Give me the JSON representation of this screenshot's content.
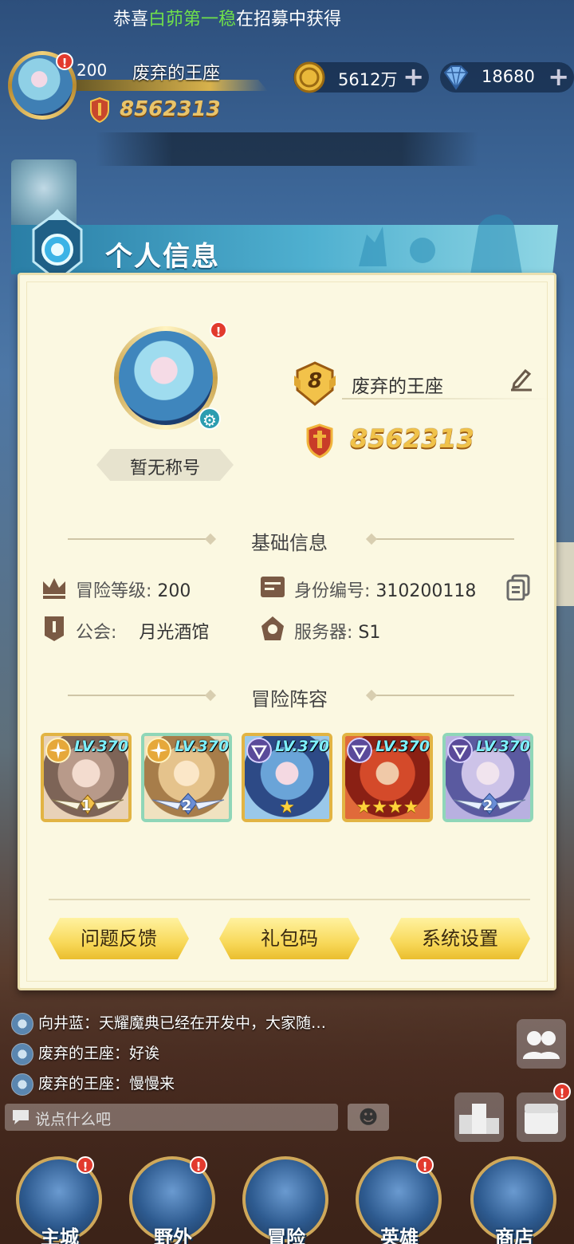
{
  "hud": {
    "level": "200",
    "player_name": "废弃的王座",
    "power": "8562313",
    "gold": "5612万",
    "gems": "18680",
    "plus": "+",
    "ticker_prefix": "恭喜",
    "ticker_highlight": "白茆第一稳",
    "ticker_suffix": "在招募中获得"
  },
  "dialog": {
    "title": "个人信息",
    "player_title": "暂无称号",
    "rank": "8",
    "name": "废弃的王座",
    "power": "8562313",
    "basic_section": "基础信息",
    "adv_level_label": "冒险等级:",
    "adv_level_value": "200",
    "id_label": "身份编号:",
    "id_value": "310200118",
    "guild_label": "公会:",
    "guild_value": "月光酒馆",
    "server_label": "服务器:",
    "server_value": "S1",
    "lineup_section": "冒险阵容",
    "heroes": [
      {
        "level": "LV.370",
        "badge": "1",
        "stars": ""
      },
      {
        "level": "LV.370",
        "badge": "2",
        "stars": ""
      },
      {
        "level": "LV.370",
        "badge": "",
        "stars": "★"
      },
      {
        "level": "LV.370",
        "badge": "",
        "stars": "★★★★"
      },
      {
        "level": "LV.370",
        "badge": "2",
        "stars": ""
      }
    ],
    "buttons": {
      "feedback": "问题反馈",
      "gift_code": "礼包码",
      "settings": "系统设置"
    }
  },
  "chat": {
    "lines": [
      "向井蓝：天耀魔典已经在开发中，大家随…",
      "废弃的王座：好诶",
      "废弃的王座：慢慢来"
    ],
    "placeholder": "说点什么吧",
    "emoji": "☻"
  },
  "nav": {
    "items": [
      "主城",
      "野外",
      "冒险",
      "英雄",
      "商店"
    ]
  },
  "colors": {
    "accent_gold": "#f0c24a",
    "header_blue": "#2a7ea6",
    "panel_bg": "#fbf8e1",
    "ticker_highlight": "#6fe04a"
  }
}
